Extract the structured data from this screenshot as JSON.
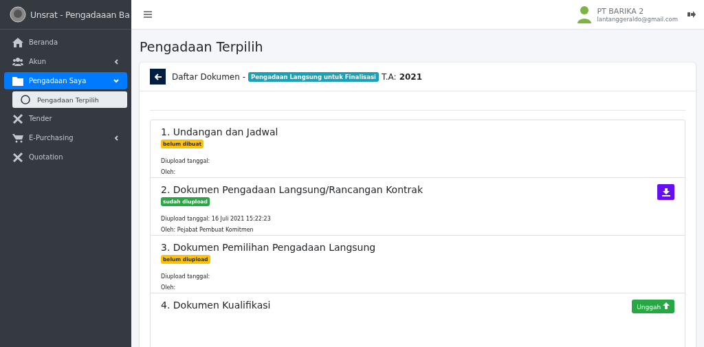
{
  "brand": {
    "title": "Unsrat - Pengadaaan Ba"
  },
  "sidebar": {
    "items": [
      {
        "kind": "home",
        "label": "Beranda",
        "selected": false
      },
      {
        "kind": "users",
        "label": "Akun",
        "selected": false,
        "expanded": false
      },
      {
        "kind": "folder",
        "label": "Pengadaan Saya",
        "selected": true,
        "expanded": true,
        "children": [
          {
            "label": "Pengadaan Terpilih",
            "selected": true
          }
        ]
      },
      {
        "kind": "tools",
        "label": "Tender",
        "selected": false
      },
      {
        "kind": "cart",
        "label": "E-Purchasing",
        "selected": false,
        "expanded": false
      },
      {
        "kind": "tools",
        "label": "Quotation",
        "selected": false
      }
    ]
  },
  "user": {
    "name": "PT BARIKA 2",
    "email": "lantanggeraldo@gmail.com"
  },
  "page": {
    "title": "Pengadaan Terpilih"
  },
  "card": {
    "heading": "Daftar Dokumen -",
    "tag": "Pengadaan Langsung untuk Finalisasi",
    "year_label": "T.A:",
    "year": "2021"
  },
  "documents": [
    {
      "title": "1. Undangan dan Jadwal",
      "status": {
        "label": "belum dibuat",
        "kind": "warning"
      },
      "uploaded": "Diupload tanggal:",
      "by": "Oleh:"
    },
    {
      "title": "2. Dokumen Pengadaan Langsung/Rancangan Kontrak",
      "status": {
        "label": "sudah diupload",
        "kind": "success"
      },
      "uploaded": "Diupload tanggal: 16 Juli 2021 15:22:23",
      "by": "Oleh: Pejabat Pembuat Komitmen",
      "action": {
        "kind": "download"
      }
    },
    {
      "title": "3. Dokumen Pemilihan Pengadaan Langsung",
      "status": {
        "label": "belum diupload",
        "kind": "warning"
      },
      "uploaded": "Diupload tanggal:",
      "by": "Oleh:"
    },
    {
      "title": "4. Dokumen Kualifikasi",
      "action": {
        "kind": "upload",
        "label": "Unggah"
      }
    }
  ]
}
